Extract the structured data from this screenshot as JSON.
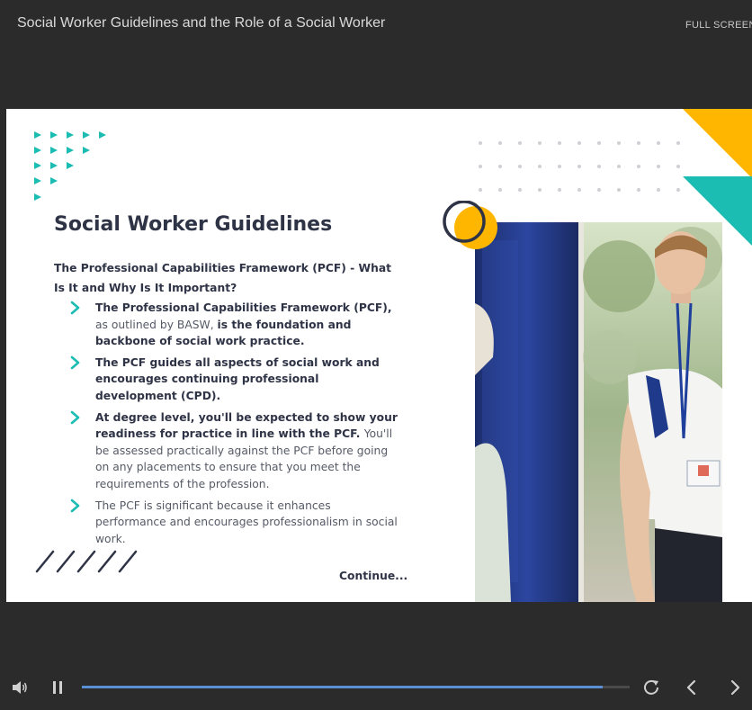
{
  "header": {
    "course_title": "Social Worker Guidelines and the Role of a Social Worker",
    "fullscreen_label": "FULL SCREEN"
  },
  "slide": {
    "title": "Social Worker Guidelines",
    "subheading": "The Professional Capabilities Framework (PCF) - What Is It and Why Is It Important?",
    "bullets": [
      {
        "segments": [
          {
            "text": "The Professional Capabilities Framework (PCF), ",
            "bold": true
          },
          {
            "text": "as outlined by BASW, ",
            "bold": false
          },
          {
            "text": "is the foundation and backbone of social work practice.",
            "bold": true
          }
        ]
      },
      {
        "segments": [
          {
            "text": "The PCF guides all aspects of social work and encourages continuing professional development (CPD).",
            "bold": true
          }
        ]
      },
      {
        "segments": [
          {
            "text": "At degree level, you'll be expected to show your readiness for practice in line with the PCF. ",
            "bold": true
          },
          {
            "text": "You'll be assessed practically against the PCF before going on any placements to ensure that you meet the requirements of the profession.",
            "bold": false
          }
        ]
      },
      {
        "segments": [
          {
            "text": "The PCF is significant because it enhances performance and encourages professionalism in social work.",
            "bold": false
          }
        ]
      }
    ],
    "continue_label": "Continue...",
    "colors": {
      "teal": "#1bbdb3",
      "yellow": "#ffb600",
      "navy": "#2e3346",
      "text_gray": "#555a66"
    }
  },
  "player": {
    "progress_fraction": 0.95,
    "icons": [
      "volume-icon",
      "pause-icon",
      "replay-icon",
      "previous-icon",
      "next-icon"
    ],
    "accent": "#5a8fd4"
  }
}
